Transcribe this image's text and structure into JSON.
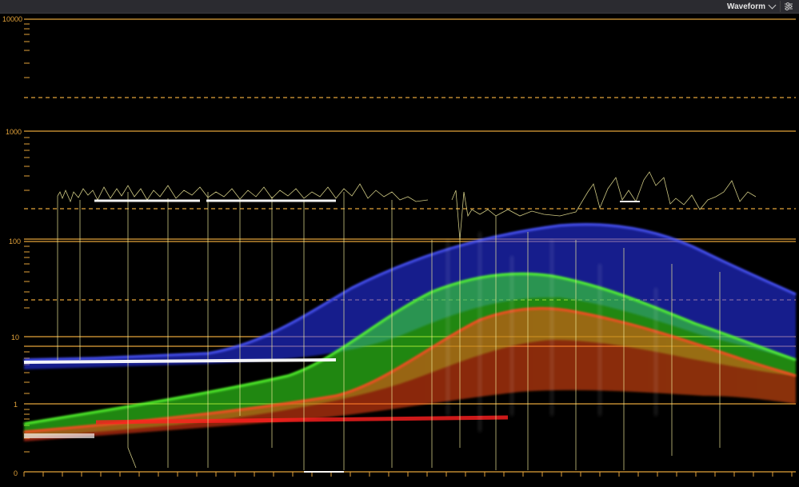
{
  "header": {
    "scope_type": "Waveform",
    "icons": {
      "dropdown": "chevron-down-icon",
      "settings": "sliders-icon"
    }
  },
  "scale": {
    "labels": [
      "10000",
      "1000",
      "100",
      "10",
      "1",
      "0"
    ],
    "unit_note": ""
  },
  "colors": {
    "graticule": "#e2a23a",
    "background": "#000000",
    "trace_red": "#ff3a1c",
    "trace_green": "#39f51e",
    "trace_blue": "#2a37ff",
    "trace_luma": "#f2ec9a"
  }
}
